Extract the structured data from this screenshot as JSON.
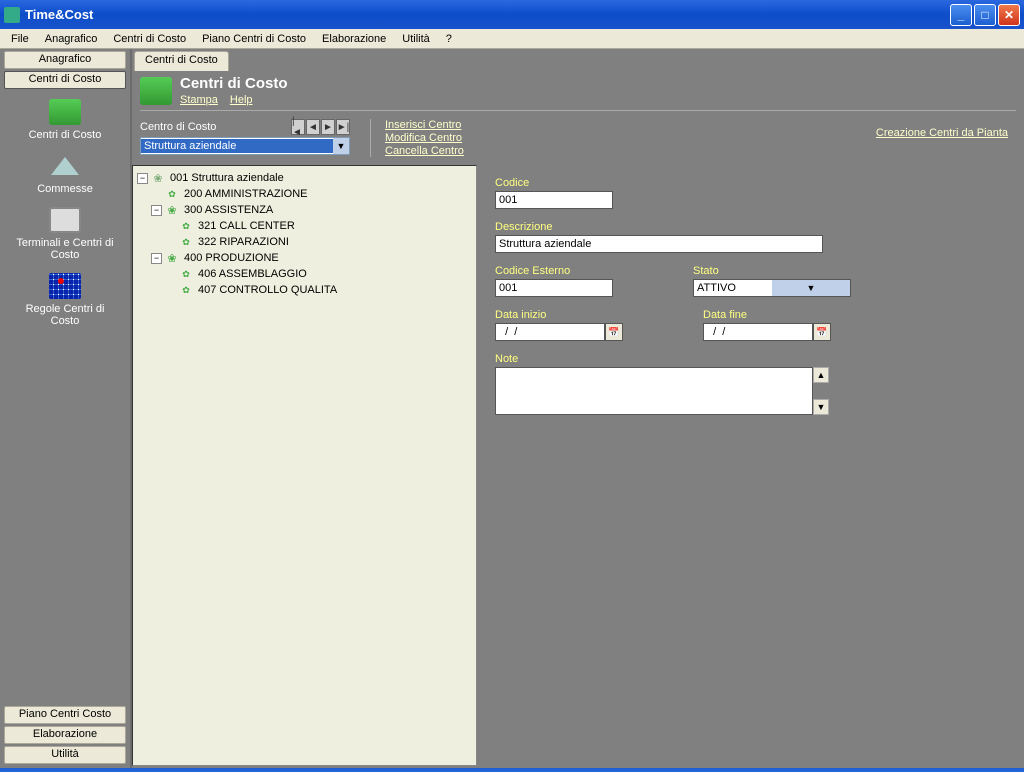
{
  "window": {
    "title": "Time&Cost"
  },
  "menubar": [
    "File",
    "Anagrafico",
    "Centri di Costo",
    "Piano Centri di Costo",
    "Elaborazione",
    "Utilità",
    "?"
  ],
  "sidebar": {
    "top_buttons": [
      "Anagrafico",
      "Centri di Costo"
    ],
    "icons": [
      {
        "label": "Centri di Costo"
      },
      {
        "label": "Commesse"
      },
      {
        "label": "Terminali e Centri di Costo"
      },
      {
        "label": "Regole Centri di Costo"
      }
    ],
    "bottom_buttons": [
      "Piano Centri Costo",
      "Elaborazione",
      "Utilità"
    ]
  },
  "tab": {
    "label": "Centri di Costo"
  },
  "header": {
    "title": "Centri di Costo",
    "links": [
      "Stampa",
      "Help"
    ],
    "combo_label": "Centro di Costo",
    "combo_value": "Struttura aziendale",
    "actions": [
      "Inserisci Centro",
      "Modifica Centro",
      "Cancella Centro"
    ],
    "right_link": "Creazione Centri da Pianta"
  },
  "tree": {
    "root": "001 Struttura aziendale",
    "n200": "200 AMMINISTRAZIONE",
    "n300": "300 ASSISTENZA",
    "n321": "321 CALL CENTER",
    "n322": "322 RIPARAZIONI",
    "n400": "400 PRODUZIONE",
    "n406": "406 ASSEMBLAGGIO",
    "n407": "407 CONTROLLO QUALITA"
  },
  "form": {
    "codice_label": "Codice",
    "codice_value": "001",
    "descrizione_label": "Descrizione",
    "descrizione_value": "Struttura aziendale",
    "codice_esterno_label": "Codice Esterno",
    "codice_esterno_value": "001",
    "stato_label": "Stato",
    "stato_value": "ATTIVO",
    "data_inizio_label": "Data inizio",
    "data_inizio_value": "  /  /",
    "data_fine_label": "Data fine",
    "data_fine_value": "  /  /",
    "note_label": "Note",
    "note_value": ""
  }
}
